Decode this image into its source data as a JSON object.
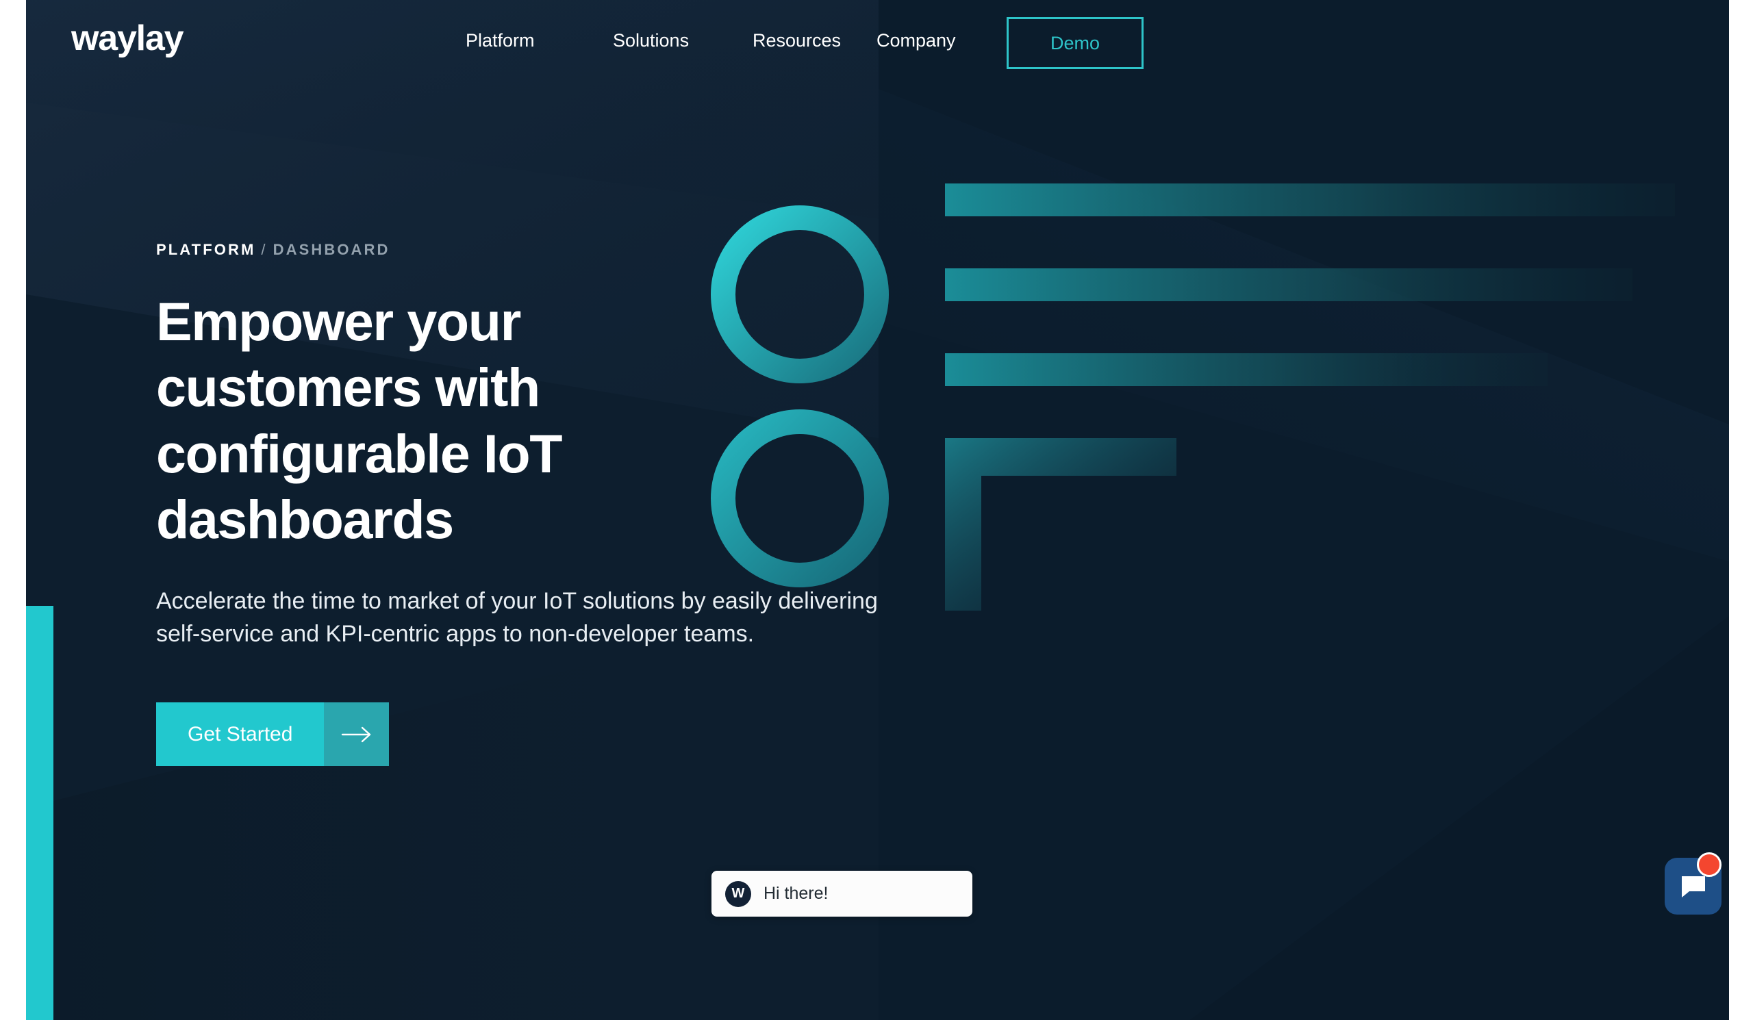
{
  "brand": {
    "logo_text": "waylay",
    "accent_teal": "#22c8ce",
    "accent_teal_border": "#2ec4c9",
    "background_navy": "#0b1c2c",
    "chat_blue": "#1e4f87",
    "badge_red": "#f4462f"
  },
  "nav": {
    "items": [
      {
        "label": "Platform"
      },
      {
        "label": "Solutions"
      },
      {
        "label": "Resources"
      },
      {
        "label": "Company"
      }
    ],
    "demo_label": "Demo"
  },
  "hero": {
    "breadcrumb": {
      "primary": "PLATFORM",
      "separator": "/",
      "secondary": "DASHBOARD"
    },
    "headline": "Empower your customers with configurable IoT dashboards",
    "subtitle": "Accelerate the time to market of your IoT solutions by easily delivering self-service and KPI-centric apps to non-developer teams.",
    "cta_label": "Get Started",
    "cta_icon": "arrow-right-icon"
  },
  "chat": {
    "avatar_initial": "W",
    "greeting": "Hi there!",
    "launcher_icon": "chat-bubble-icon",
    "badge_icon": "notification-dot"
  },
  "graphic": {
    "name": "iot-dashboard-abstract-graphic",
    "elements": [
      "ring-top",
      "ring-bottom",
      "bar-1",
      "bar-2",
      "bar-3",
      "corner-frame"
    ]
  },
  "scrollbar": {
    "orientation": "vertical",
    "position": "top"
  }
}
